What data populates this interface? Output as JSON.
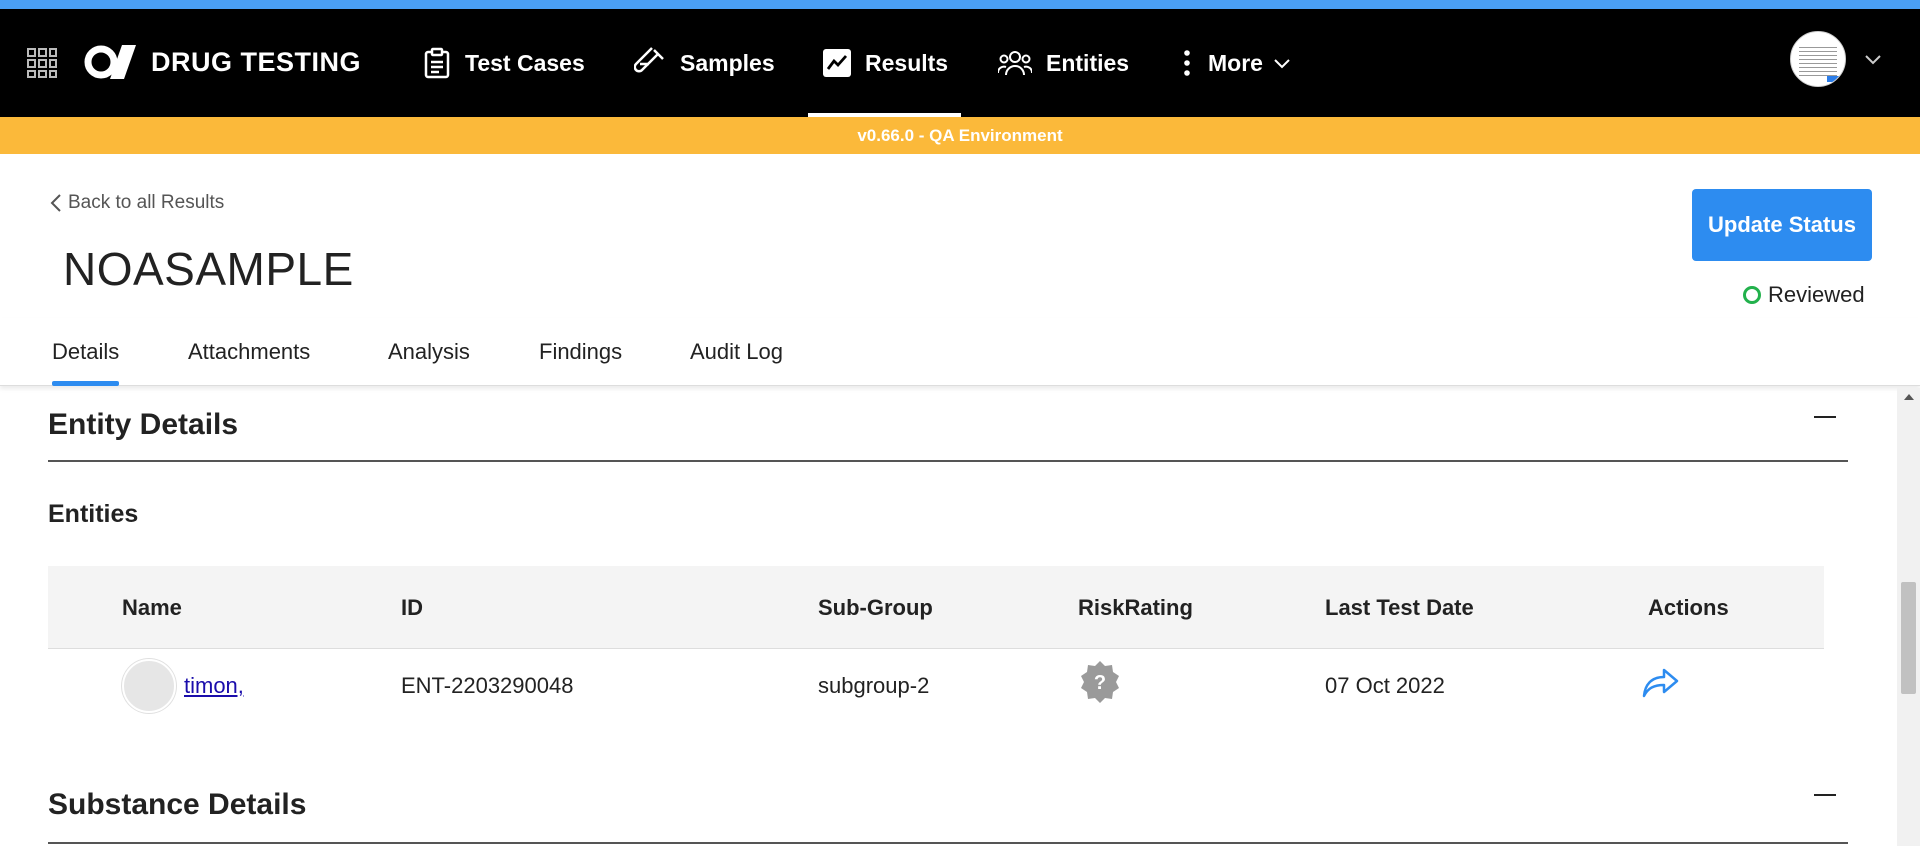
{
  "nav": {
    "brand": "DRUG TESTING",
    "items": [
      {
        "label": "Test Cases",
        "icon": "clipboard-icon"
      },
      {
        "label": "Samples",
        "icon": "test-tube-icon"
      },
      {
        "label": "Results",
        "icon": "chart-line-icon",
        "active": true
      },
      {
        "label": "Entities",
        "icon": "users-icon"
      },
      {
        "label": "More",
        "icon": "kebab-menu-icon"
      }
    ]
  },
  "env_banner": "v0.66.0 - QA Environment",
  "header": {
    "back_label": "Back to all Results",
    "title": "NOASAMPLE",
    "update_button": "Update Status",
    "status": "Reviewed",
    "status_color": "#22b14c"
  },
  "tabs": [
    "Details",
    "Attachments",
    "Analysis",
    "Findings",
    "Audit Log"
  ],
  "active_tab": "Details",
  "entity_section": {
    "title": "Entity Details",
    "subtitle": "Entities",
    "columns": [
      "Name",
      "ID",
      "Sub-Group",
      "RiskRating",
      "Last Test Date",
      "Actions"
    ],
    "rows": [
      {
        "name": "timon,",
        "id": "ENT-2203290048",
        "sub_group": "subgroup-2",
        "risk_icon": "unknown-badge-icon",
        "last_test_date": "07 Oct 2022",
        "action_icon": "share-arrow-icon"
      }
    ]
  },
  "substance_section": {
    "title": "Substance Details"
  },
  "colors": {
    "accent": "#4a9ff5",
    "banner": "#fbb93a",
    "primary_button": "#2d8cf0"
  }
}
